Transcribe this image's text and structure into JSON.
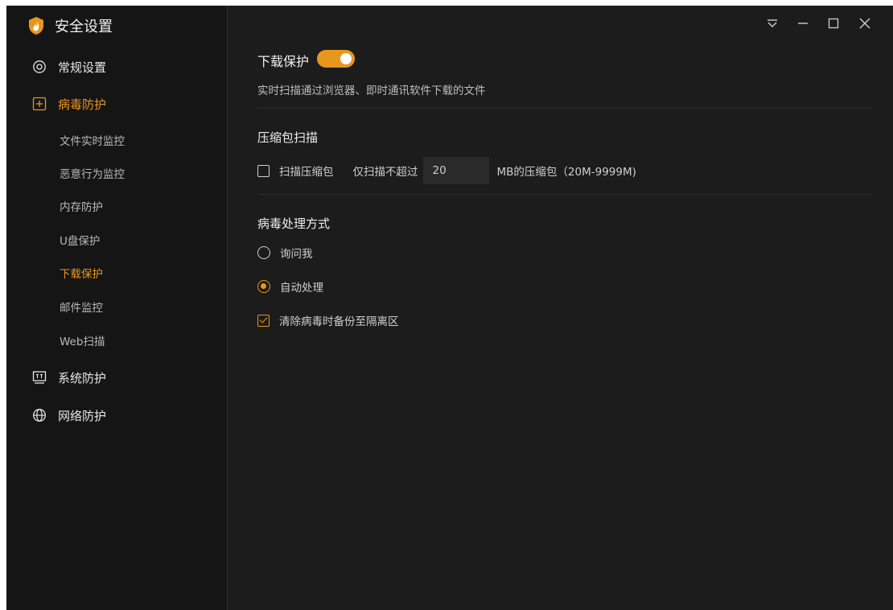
{
  "app": {
    "title": "安全设置",
    "icon": "shield-flame-icon"
  },
  "colors": {
    "accent": "#e8961e",
    "sidebar_bg": "#151515",
    "main_bg": "#1c1c1c"
  },
  "sidebar": {
    "items": [
      {
        "label": "常规设置",
        "icon": "gear-icon"
      },
      {
        "label": "病毒防护",
        "icon": "plus-box-icon",
        "active": true
      },
      {
        "label": "系统防护",
        "icon": "monitor-icon"
      },
      {
        "label": "网络防护",
        "icon": "globe-icon"
      }
    ],
    "subitems": [
      {
        "label": "文件实时监控"
      },
      {
        "label": "恶意行为监控"
      },
      {
        "label": "内存防护"
      },
      {
        "label": "U盘保护"
      },
      {
        "label": "下载保护",
        "active": true
      },
      {
        "label": "邮件监控"
      },
      {
        "label": "Web扫描"
      }
    ]
  },
  "window_controls": [
    "menu-icon",
    "minimize-icon",
    "maximize-icon",
    "close-icon"
  ],
  "download_protection": {
    "title": "下载保护",
    "enabled": true,
    "description": "实时扫描通过浏览器、即时通讯软件下载的文件"
  },
  "archive_scan": {
    "title": "压缩包扫描",
    "checkbox_label": "扫描压缩包",
    "checked": false,
    "limit_prefix": "仅扫描不超过",
    "limit_value": "20",
    "limit_suffix": "MB的压缩包（20M-9999M)"
  },
  "virus_handling": {
    "title": "病毒处理方式",
    "options": [
      {
        "label": "询问我",
        "selected": false
      },
      {
        "label": "自动处理",
        "selected": true
      }
    ],
    "backup_label": "清除病毒时备份至隔离区",
    "backup_checked": true
  }
}
